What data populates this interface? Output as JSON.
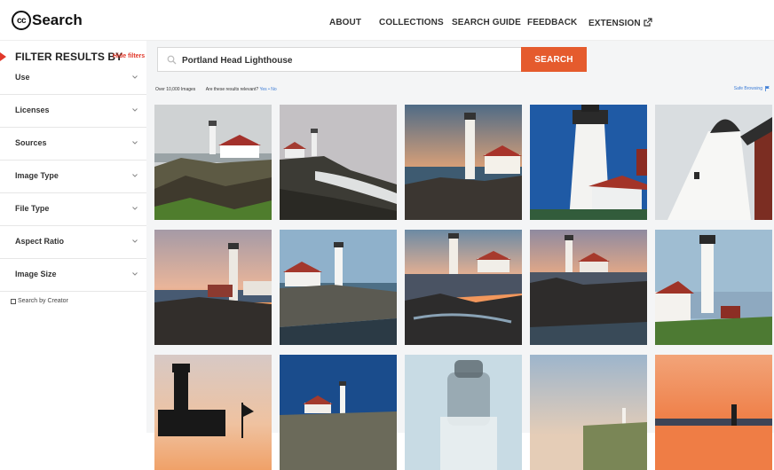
{
  "header": {
    "logo_icon": "cc-logo-icon",
    "logo_badge": "cc",
    "logo_text": "Search",
    "nav": [
      "ABOUT",
      "COLLECTIONS",
      "SEARCH GUIDE",
      "FEEDBACK",
      "EXTENSION"
    ],
    "extension_icon": "external-link-icon"
  },
  "sidebar": {
    "title": "FILTER RESULTS BY",
    "hide_label": "Hide filters",
    "filters": [
      "Use",
      "Licenses",
      "Sources",
      "Image Type",
      "File Type",
      "Aspect Ratio",
      "Image Size"
    ],
    "creator_label": "Search by Creator",
    "creator_checked": false
  },
  "search": {
    "value": "Portland Head Lighthouse",
    "button_label": "SEARCH",
    "icon": "search-icon"
  },
  "results": {
    "count_text": "Over 10,000 Images",
    "relevance_question": "Are these results relevant?",
    "yes_label": "Yes",
    "separator": "•",
    "no_label": "No",
    "safe_browsing_label": "Safe Browsing",
    "safe_browsing_icon": "flag-icon"
  },
  "colors": {
    "accent": "#e55b2d",
    "hide_filters": "#e1382a",
    "link": "#3c7cd6",
    "panel_bg": "#f4f5f6"
  },
  "images": [
    {
      "subject": "lighthouse-overcast-coast"
    },
    {
      "subject": "lighthouse-foggy-waves"
    },
    {
      "subject": "lighthouse-sunset-rocks"
    },
    {
      "subject": "lighthouse-tower-blue-sky"
    },
    {
      "subject": "lighthouse-tower-low-angle"
    },
    {
      "subject": "lighthouse-dusk-orange"
    },
    {
      "subject": "lighthouse-daytime-coast"
    },
    {
      "subject": "lighthouse-sunrise-shore"
    },
    {
      "subject": "lighthouse-sunset-cliffs"
    },
    {
      "subject": "lighthouse-green-lawn"
    },
    {
      "subject": "lighthouse-silhouette"
    },
    {
      "subject": "lighthouse-deep-blue-sky"
    },
    {
      "subject": "lighthouse-blurred-closeup"
    },
    {
      "subject": "lighthouse-distant-evening"
    },
    {
      "subject": "lighthouse-orange-horizon"
    }
  ]
}
